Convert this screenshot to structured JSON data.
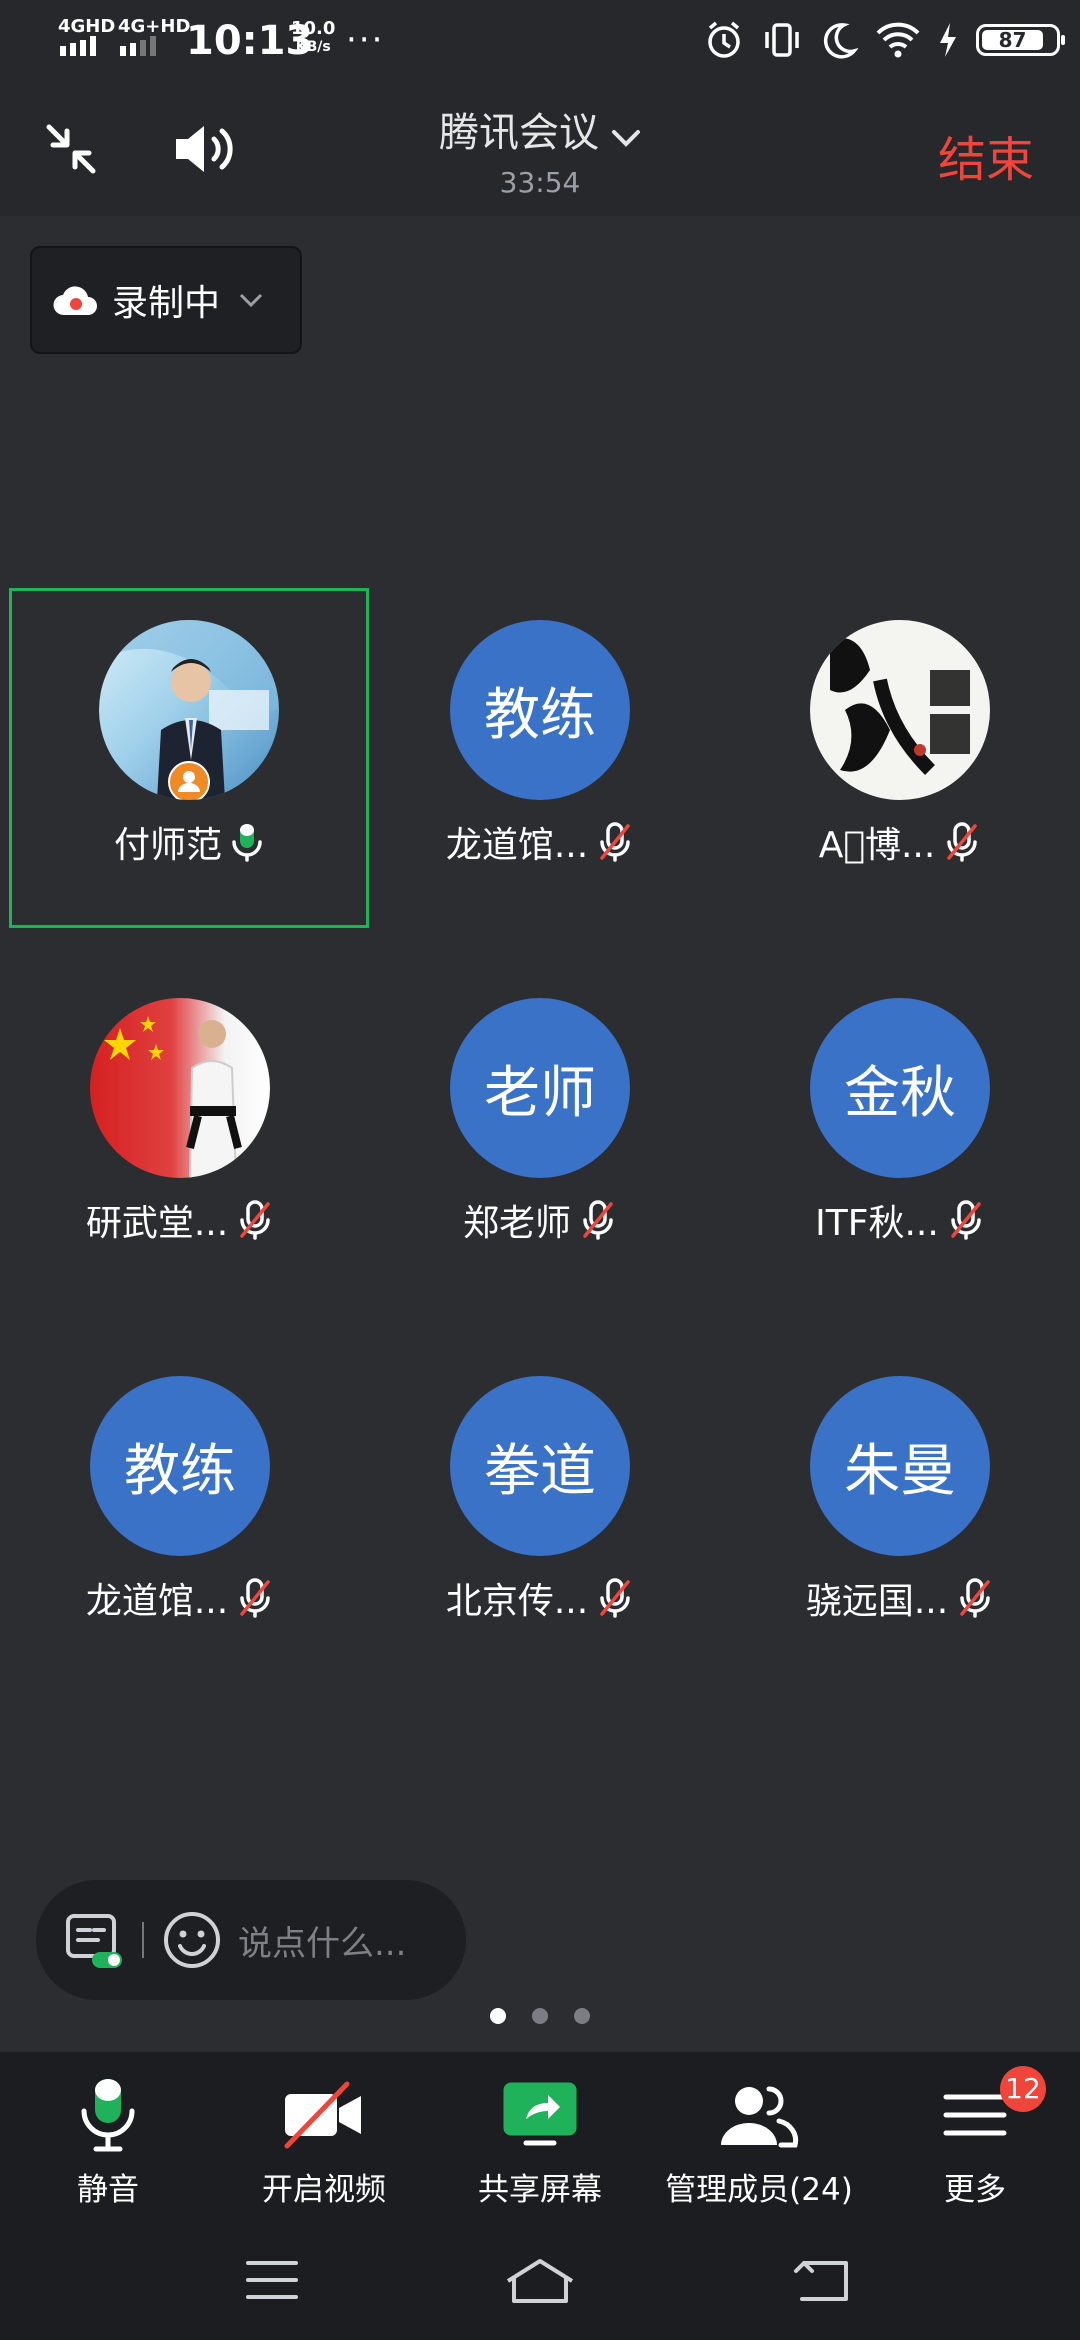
{
  "status_bar": {
    "signal1": "4GHD",
    "signal2": "4G+HD",
    "time": "10:13",
    "speed_value": "10.0",
    "speed_unit": "KB/s",
    "dots": "···",
    "battery": "87"
  },
  "header": {
    "title": "腾讯会议",
    "timer": "33:54",
    "end_label": "结束"
  },
  "recording": {
    "label": "录制中"
  },
  "participants": [
    {
      "name": "付师范",
      "avatar_text": "",
      "mic": "on"
    },
    {
      "name": "龙道馆...",
      "avatar_text": "教练",
      "mic": "muted"
    },
    {
      "name": "A􏿾博...",
      "avatar_text": "",
      "mic": "muted"
    },
    {
      "name": "研武堂...",
      "avatar_text": "",
      "mic": "muted"
    },
    {
      "name": "郑老师",
      "avatar_text": "老师",
      "mic": "muted"
    },
    {
      "name": "ITF秋...",
      "avatar_text": "金秋",
      "mic": "muted"
    },
    {
      "name": "龙道馆...",
      "avatar_text": "教练",
      "mic": "muted"
    },
    {
      "name": "北京传...",
      "avatar_text": "拳道",
      "mic": "muted"
    },
    {
      "name": "骁远国...",
      "avatar_text": "朱曼",
      "mic": "muted"
    }
  ],
  "chat": {
    "placeholder": "说点什么..."
  },
  "pager": {
    "pages": 3,
    "current": 1
  },
  "toolbar": {
    "mute": "静音",
    "video": "开启视频",
    "share": "共享屏幕",
    "members": "管理成员(24)",
    "more": "更多",
    "more_badge": "12"
  },
  "colors": {
    "accent_green": "#1fb25a",
    "end_red": "#f0453a",
    "avatar_blue": "#3a72c8"
  }
}
